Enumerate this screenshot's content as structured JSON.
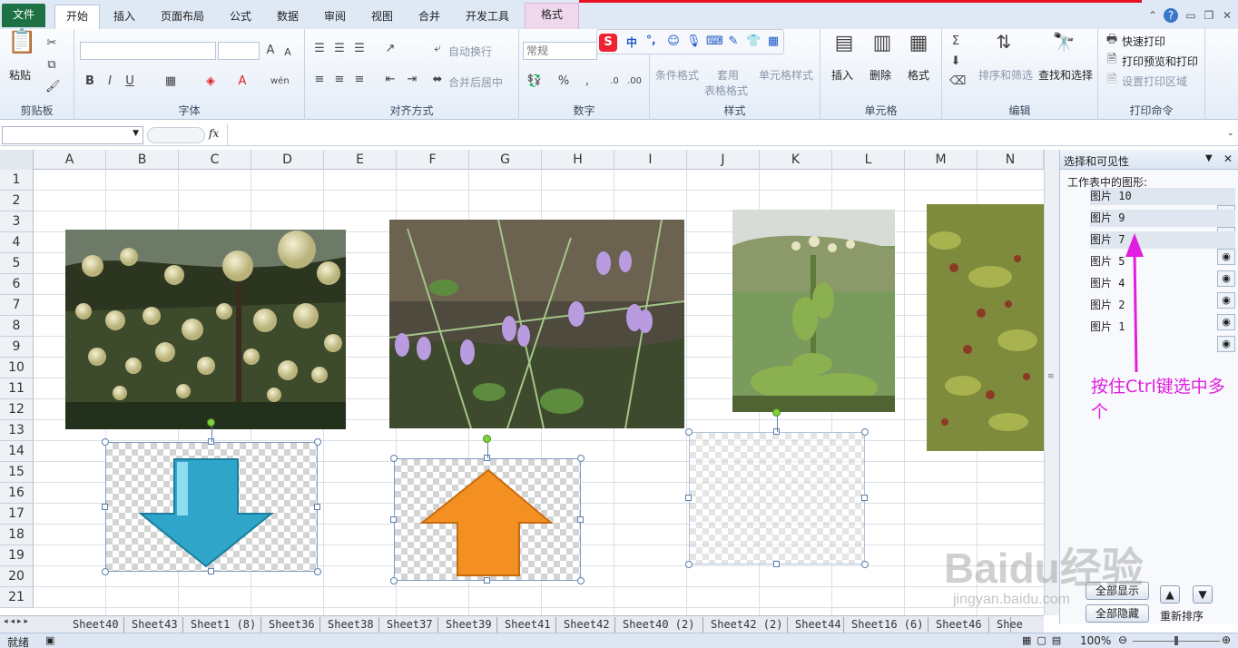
{
  "ribbon_tabs": {
    "file": "文件",
    "home": "开始",
    "insert": "插入",
    "layout": "页面布局",
    "formula": "公式",
    "data": "数据",
    "review": "审阅",
    "view": "视图",
    "merge": "合并",
    "developer": "开发工具",
    "format": "格式"
  },
  "groups": {
    "clipboard": {
      "label": "剪贴板",
      "paste": "粘贴"
    },
    "font": {
      "label": "字体"
    },
    "align": {
      "label": "对齐方式",
      "wrap": "自动换行",
      "merge": "合并后居中"
    },
    "number": {
      "label": "数字",
      "format": "常规"
    },
    "styles": {
      "label": "样式",
      "cond": "条件格式",
      "table1": "套用",
      "table2": "表格格式",
      "cell": "单元格样式"
    },
    "cells": {
      "label": "单元格",
      "insert": "插入",
      "delete": "删除",
      "format": "格式"
    },
    "edit": {
      "label": "编辑",
      "sort": "排序和筛选",
      "find": "查找和选择"
    },
    "print": {
      "label": "打印命令",
      "quick": "快速打印",
      "preview": "打印预览和打印",
      "area": "设置打印区域"
    }
  },
  "sogou": {
    "zh": "中",
    "punct": "°,"
  },
  "formula_bar": {
    "fx": "fx",
    "name_box": ""
  },
  "columns": [
    "A",
    "B",
    "C",
    "D",
    "E",
    "F",
    "G",
    "H",
    "I",
    "J",
    "K",
    "L",
    "M",
    "N"
  ],
  "rows": [
    "1",
    "2",
    "3",
    "4",
    "5",
    "6",
    "7",
    "8",
    "9",
    "10",
    "11",
    "12",
    "13",
    "14",
    "15",
    "16",
    "17",
    "18",
    "19",
    "20",
    "21"
  ],
  "pane": {
    "title": "选择和可见性",
    "subtitle": "工作表中的图形:",
    "items": [
      "图片 10",
      "图片 9",
      "图片 7",
      "图片 5",
      "图片 4",
      "图片 2",
      "图片 1"
    ],
    "show_all": "全部显示",
    "hide_all": "全部隐藏",
    "reorder": "重新排序"
  },
  "annotation": "按住Ctrl键选中多个",
  "sheets": [
    "Sheet40",
    "Sheet43",
    "Sheet1 (8)",
    "Sheet36",
    "Sheet38",
    "Sheet37",
    "Sheet39",
    "Sheet41",
    "Sheet42",
    "Sheet40 (2)",
    "Sheet42 (2)",
    "Sheet44",
    "Sheet16 (6)",
    "Sheet46",
    "Shee"
  ],
  "status": {
    "ready": "就绪",
    "zoom": "100%"
  },
  "watermark": {
    "brand": "Baidu经验",
    "url": "jingyan.baidu.com"
  },
  "colors": {
    "accent_file": "#1e7145",
    "annotation": "#e11ee0",
    "arrow_blue": "#2fa6c9",
    "arrow_orange": "#f39021"
  }
}
